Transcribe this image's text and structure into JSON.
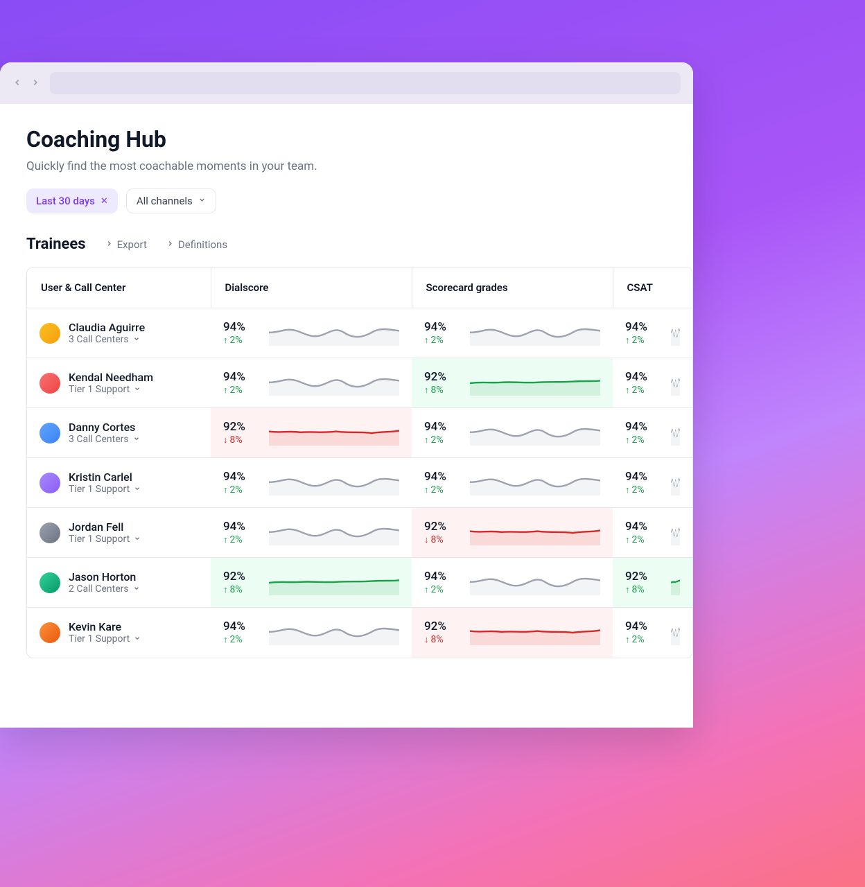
{
  "page": {
    "title": "Coaching Hub",
    "subtitle": "Quickly find the most coachable moments in your team."
  },
  "filters": {
    "date_label": "Last 30 days",
    "channel_label": "All channels"
  },
  "section": {
    "title": "Trainees",
    "export_label": "Export",
    "definitions_label": "Definitions"
  },
  "columns": {
    "user": "User & Call Center",
    "dialscore": "Dialscore",
    "scorecard": "Scorecard grades",
    "csat": "CSAT"
  },
  "trainees": [
    {
      "name": "Claudia Aguirre",
      "sub": "3 Call Centers",
      "avatar": "a1",
      "dialscore": {
        "value": "94%",
        "delta": "2%",
        "dir": "up",
        "spark": "neutral",
        "hl": "none"
      },
      "scorecard": {
        "value": "94%",
        "delta": "2%",
        "dir": "up",
        "spark": "neutral",
        "hl": "none"
      },
      "csat": {
        "value": "94%",
        "delta": "2%",
        "dir": "up",
        "spark": "neutral",
        "hl": "none"
      }
    },
    {
      "name": "Kendal Needham",
      "sub": "Tier 1 Support",
      "avatar": "a2",
      "dialscore": {
        "value": "94%",
        "delta": "2%",
        "dir": "up",
        "spark": "neutral",
        "hl": "none"
      },
      "scorecard": {
        "value": "92%",
        "delta": "8%",
        "dir": "up",
        "spark": "green",
        "hl": "up"
      },
      "csat": {
        "value": "94%",
        "delta": "2%",
        "dir": "up",
        "spark": "neutral",
        "hl": "none"
      }
    },
    {
      "name": "Danny Cortes",
      "sub": "3 Call Centers",
      "avatar": "a3",
      "dialscore": {
        "value": "92%",
        "delta": "8%",
        "dir": "down",
        "spark": "red",
        "hl": "down"
      },
      "scorecard": {
        "value": "94%",
        "delta": "2%",
        "dir": "up",
        "spark": "neutral",
        "hl": "none"
      },
      "csat": {
        "value": "94%",
        "delta": "2%",
        "dir": "up",
        "spark": "neutral",
        "hl": "none"
      }
    },
    {
      "name": "Kristin Carlel",
      "sub": "Tier 1 Support",
      "avatar": "a4",
      "dialscore": {
        "value": "94%",
        "delta": "2%",
        "dir": "up",
        "spark": "neutral",
        "hl": "none"
      },
      "scorecard": {
        "value": "94%",
        "delta": "2%",
        "dir": "up",
        "spark": "neutral",
        "hl": "none"
      },
      "csat": {
        "value": "94%",
        "delta": "2%",
        "dir": "up",
        "spark": "neutral",
        "hl": "none"
      }
    },
    {
      "name": "Jordan Fell",
      "sub": "Tier 1 Support",
      "avatar": "a5",
      "dialscore": {
        "value": "94%",
        "delta": "2%",
        "dir": "up",
        "spark": "neutral",
        "hl": "none"
      },
      "scorecard": {
        "value": "92%",
        "delta": "8%",
        "dir": "down",
        "spark": "red",
        "hl": "down"
      },
      "csat": {
        "value": "94%",
        "delta": "2%",
        "dir": "up",
        "spark": "neutral",
        "hl": "none"
      }
    },
    {
      "name": "Jason Horton",
      "sub": "2 Call Centers",
      "avatar": "a6",
      "dialscore": {
        "value": "92%",
        "delta": "8%",
        "dir": "up",
        "spark": "green",
        "hl": "up"
      },
      "scorecard": {
        "value": "94%",
        "delta": "2%",
        "dir": "up",
        "spark": "neutral",
        "hl": "none"
      },
      "csat": {
        "value": "92%",
        "delta": "8%",
        "dir": "up",
        "spark": "green",
        "hl": "up"
      }
    },
    {
      "name": "Kevin Kare",
      "sub": "Tier 1 Support",
      "avatar": "a7",
      "dialscore": {
        "value": "94%",
        "delta": "2%",
        "dir": "up",
        "spark": "neutral",
        "hl": "none"
      },
      "scorecard": {
        "value": "92%",
        "delta": "8%",
        "dir": "down",
        "spark": "red",
        "hl": "down"
      },
      "csat": {
        "value": "94%",
        "delta": "2%",
        "dir": "up",
        "spark": "neutral",
        "hl": "none"
      }
    }
  ]
}
